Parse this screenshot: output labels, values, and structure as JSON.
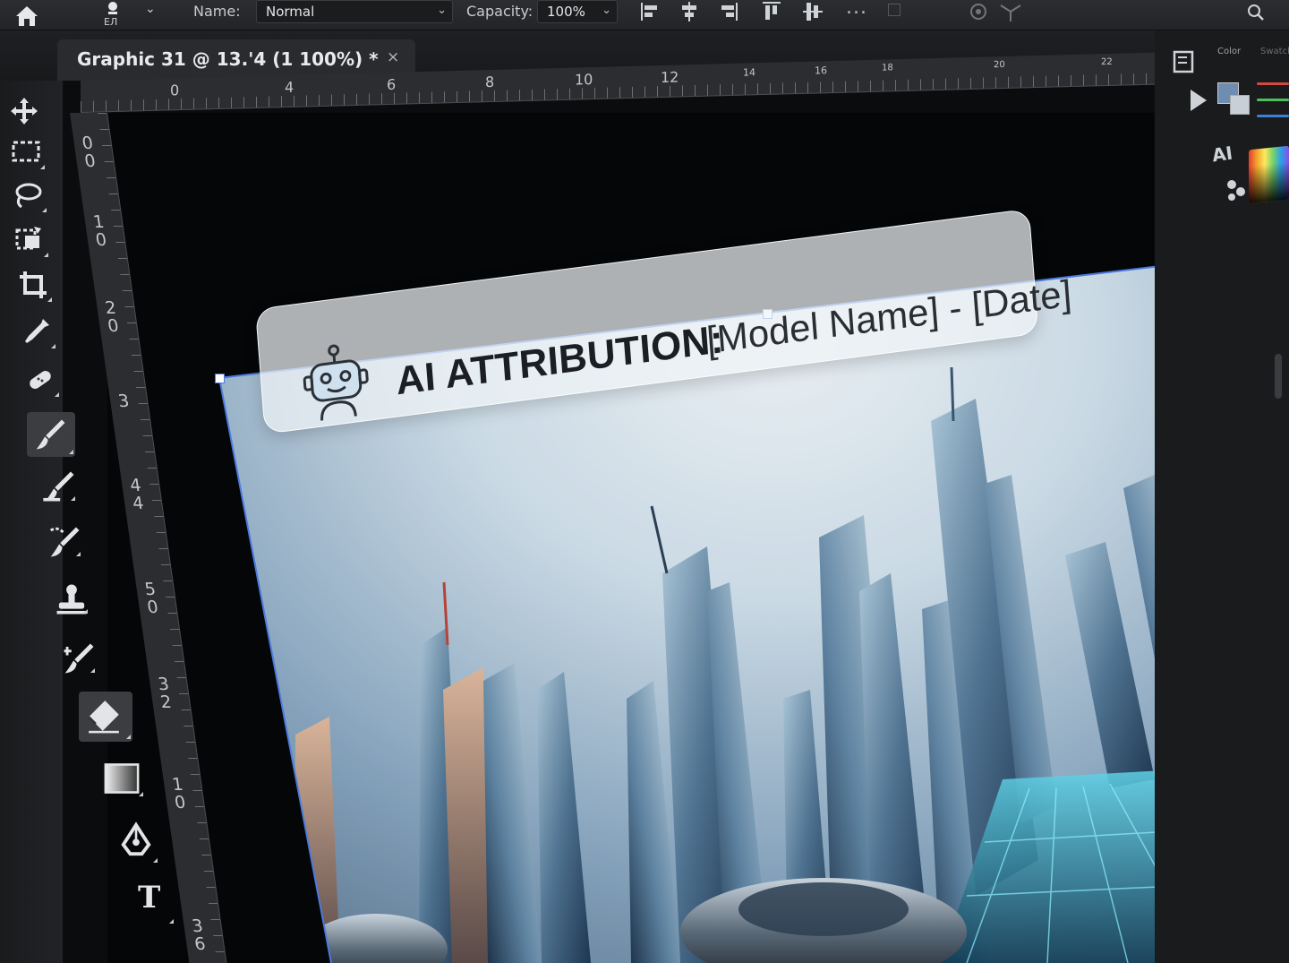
{
  "options_bar": {
    "preset_label": "EЛ",
    "name_label": "Name:",
    "name_value": "Normal",
    "capacity_label": "Capacity:",
    "capacity_value": "100%",
    "more_label": "..."
  },
  "document_tab": {
    "title": "Graphic 31 @ 13.'4 (1 100%) *",
    "close_label": "×"
  },
  "ruler_top": {
    "labels": [
      "0",
      "4",
      "6",
      "8",
      "10",
      "12",
      "14",
      "16",
      "18",
      "20",
      "22"
    ]
  },
  "ruler_left": {
    "labels": [
      "0\n0",
      "1\n0",
      "2\n0",
      "3",
      "4\n4",
      "5\n0",
      "3\n2",
      "1\n0",
      "3\n6"
    ]
  },
  "toolbar": {
    "tools": [
      {
        "name": "move-tool",
        "icon": "move-icon"
      },
      {
        "name": "marquee-tool",
        "icon": "marquee-icon"
      },
      {
        "name": "lasso-tool",
        "icon": "lasso-icon"
      },
      {
        "name": "object-select-tool",
        "icon": "object-select-icon"
      },
      {
        "name": "crop-tool",
        "icon": "crop-icon"
      },
      {
        "name": "eyedropper-tool",
        "icon": "eyedropper-icon"
      },
      {
        "name": "healing-tool",
        "icon": "bandage-icon"
      },
      {
        "name": "brush-tool",
        "icon": "brush-icon",
        "active": true
      },
      {
        "name": "mixer-brush-tool",
        "icon": "mixer-brush-icon"
      },
      {
        "name": "history-brush-tool",
        "icon": "history-brush-icon"
      },
      {
        "name": "clone-stamp-tool",
        "icon": "stamp-icon"
      },
      {
        "name": "art-history-tool",
        "icon": "art-brush-icon"
      },
      {
        "name": "eraser-tool",
        "icon": "eraser-icon",
        "active": true
      },
      {
        "name": "gradient-tool",
        "icon": "gradient-icon"
      },
      {
        "name": "pen-tool",
        "icon": "pen-icon"
      },
      {
        "name": "type-tool",
        "icon": "type-icon",
        "glyph": "T"
      }
    ]
  },
  "canvas": {
    "attribution_label": "AI ATTRIBUTION:",
    "attribution_value": "[Model Name] - [Date]",
    "attribution_icon": "robot-icon"
  },
  "right_dock": {
    "tab_color": "Color",
    "tab_swatches": "Swatches",
    "ai_label": "AI",
    "foreground_color": "#6e8db0",
    "background_color": "#c8cfd6"
  }
}
